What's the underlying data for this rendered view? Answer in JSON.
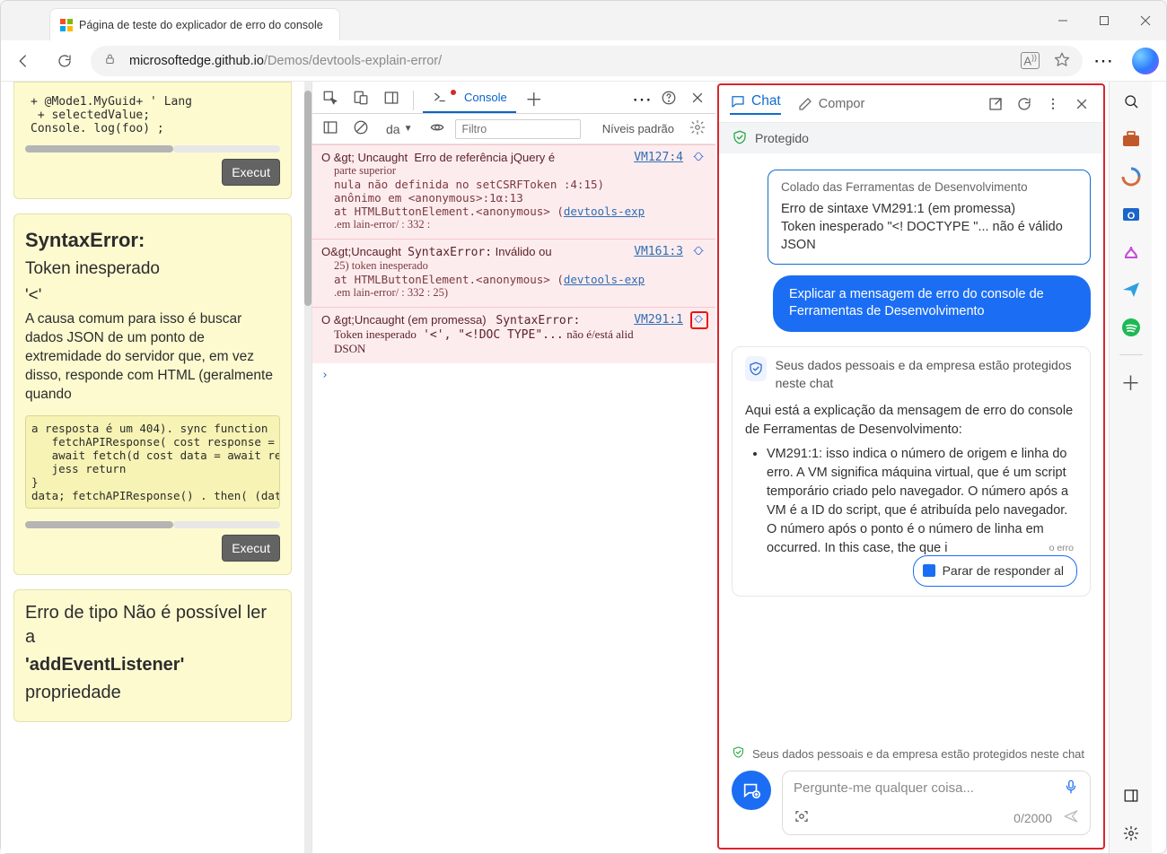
{
  "browser": {
    "tab_title": "Página de teste do explicador de erro do console",
    "url_host": "microsoftedge.github.io",
    "url_path": "/Demos/devtools-explain-error/"
  },
  "page": {
    "card1_pre": "+ @Mode1.MyGuid+ ' Lang\n + selectedValue;\nConsole. log(foo) ;",
    "card1_exec": "Execut",
    "card2_title": "SyntaxError:",
    "card2_sub1": "Token inesperado",
    "card2_sub2": "'<'",
    "card2_body": "A causa comum para isso é buscar dados JSON de um ponto de extremidade do servidor que, em vez disso, responde com HTML (geralmente quando",
    "card2_pre": "a resposta é um 404). sync function\n   fetchAPIResponse( cost response =\n   await fetch(d cost data = await response.\n   jess return\n}\ndata; fetchAPIResponse() . then( (data )    =",
    "card2_exec": "Execut",
    "card3_line1": "Erro de tipo Não é possível ler a",
    "card3_strong": "'addEventListener'",
    "card3_line3": "propriedade"
  },
  "devtools": {
    "tab_console": "Console",
    "level_select": "da",
    "filter_placeholder": "Filtro",
    "levels_label": "Níveis padrão",
    "errors": [
      {
        "head": "O &gt; Uncaught",
        "msg1": "Erro de referência jQuery é",
        "loc": "VM127:4",
        "msg2": "parte superior",
        "trace1": "nula não definida no setCSRFToken   :4:15)",
        "trace2": "anônimo em <anonymous>:1α:13",
        "trace3": "at  HTMLButtonElement.<anonymous> (",
        "tracelink": "devtools-exp",
        "trace4": ".em lain-error/ : 332 :"
      },
      {
        "head": "O&gt;Uncaught",
        "code": "SyntaxError:",
        "msg1": "Inválido ou",
        "loc": "VM161:3",
        "trace1": "25) token inesperado",
        "trace2": "at  HTMLButtonElement.<anonymous> (",
        "tracelink": "devtools-exp",
        "trace3": ".em lain-error/ : 332 : 25)"
      },
      {
        "head": "O &gt;Uncaught (em promessa)",
        "code": "SyntaxError:",
        "loc": "VM291:1",
        "line2a": "Token inesperado",
        "line2b": "'<',  \"<!DOC TYPE\"...",
        "line2c": "não é/está alid",
        "line3": "DSON"
      }
    ]
  },
  "copilot": {
    "tab_chat": "Chat",
    "tab_compose": "Compor",
    "protected_label": "Protegido",
    "user_pasted": "Colado das Ferramentas de Desenvolvimento",
    "user_line1": "Erro de sintaxe VM291:1 (em promessa)",
    "user_line2": "Token inesperado \"<! DOCTYPE \"... não é válido JSON",
    "suggestion": "Explicar a mensagem de erro do console de Ferramentas de Desenvolvimento",
    "ai_protect": "Seus dados pessoais e da empresa estão protegidos neste chat",
    "ai_intro": "Aqui está a explicação da mensagem de erro do console de Ferramentas de Desenvolvimento:",
    "ai_bullet": "VM291:1: isso indica o número de origem e linha do erro. A VM significa máquina virtual, que é um script temporário criado pelo navegador. O número após a VM é a ID do script, que é atribuída pelo navegador. O número após o ponto é o número de linha em       occurred. In this case, the que     i",
    "ai_side_note": "o erro",
    "stop_label": "Parar de responder al",
    "footer_protect": "Seus dados pessoais e da empresa estão protegidos neste chat",
    "input_placeholder": "Pergunte-me qualquer coisa...",
    "char_count": "0/2000"
  }
}
